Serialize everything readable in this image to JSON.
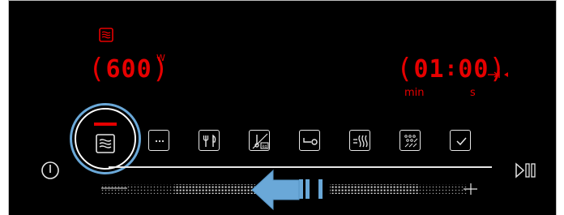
{
  "power": {
    "value": "600",
    "unit": "W"
  },
  "timer": {
    "minutes": "01",
    "seconds": "00",
    "min_label": "min",
    "sec_label": "s"
  },
  "programs": [
    {
      "name": "microwave",
      "icon": "microwave-waves-icon",
      "selected": true
    },
    {
      "name": "more",
      "icon": "ellipsis-icon"
    },
    {
      "name": "cooking-assist",
      "icon": "fork-knife-icon"
    },
    {
      "name": "weight-program",
      "icon": "weight-kg-icon",
      "weight_unit": "kg"
    },
    {
      "name": "child-lock",
      "icon": "key-icon"
    },
    {
      "name": "steam",
      "icon": "steam-icon"
    },
    {
      "name": "cleaning",
      "icon": "drops-icon"
    },
    {
      "name": "confirm",
      "icon": "checkmark-icon"
    }
  ],
  "colors": {
    "background": "#000000",
    "display_red": "#e60000",
    "highlight_blue": "#6aa8d8",
    "icon_white": "#e6e6e6"
  }
}
